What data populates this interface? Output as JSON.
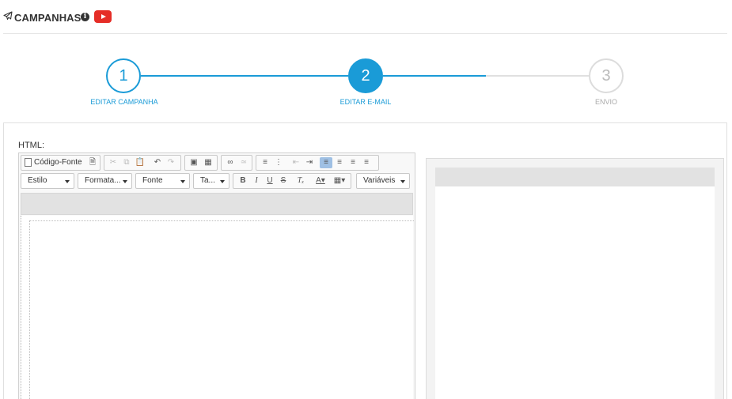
{
  "header": {
    "title": "CAMPANHAS",
    "info_icon": "info-icon",
    "video_icon": "youtube-icon",
    "brand_red": "#e52d27"
  },
  "wizard": {
    "accent": "#1a9bd7",
    "steps": [
      {
        "number": "1",
        "label": "EDITAR CAMPANHA",
        "state": "done"
      },
      {
        "number": "2",
        "label": "EDITAR E-MAIL",
        "state": "current"
      },
      {
        "number": "3",
        "label": "ENVIO",
        "state": "todo"
      }
    ]
  },
  "editor": {
    "label": "HTML:",
    "toolbar": {
      "source_label": "Código-Fonte",
      "style_label": "Estilo",
      "format_label": "Formata...",
      "font_label": "Fonte",
      "size_label": "Ta...",
      "variables_label": "Variáveis",
      "bold_label": "B",
      "italic_label": "I",
      "underline_label": "U",
      "strike_label": "S"
    }
  }
}
